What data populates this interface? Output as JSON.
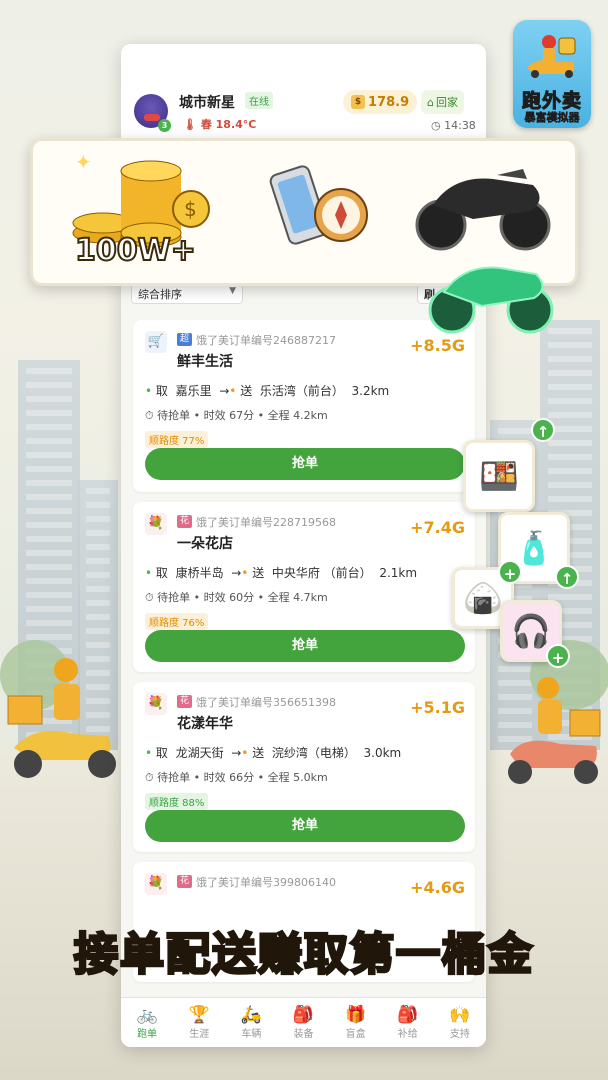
{
  "app_logo": {
    "title": "跑外卖",
    "subtitle": "暴富模拟器"
  },
  "header": {
    "user_name": "城市新星",
    "online": "在线",
    "level": "3",
    "weather": "春 18.4°C",
    "coins": "178.9",
    "home": "回家",
    "time": "14:38"
  },
  "toolbar": {
    "sort": "综合排序",
    "refresh": "刷"
  },
  "orders": [
    {
      "icon": "cart-icon",
      "tag": "超",
      "tag_color": "#4a7fd8",
      "order": "饿了美订单编号246887217",
      "name": "鲜丰生活",
      "earn": "+8.5G",
      "pickup": "嘉乐里",
      "dropoff": "乐活湾（前台）",
      "dist": "3.2km",
      "status": "待抢单",
      "timeliness": "时效 67分",
      "total": "全程 4.2km",
      "smooth": "顺路度 77%",
      "button": "抢单"
    },
    {
      "icon": "flower-icon",
      "tag": "花",
      "tag_color": "#e06b8a",
      "order": "饿了美订单编号228719568",
      "name": "一朵花店",
      "earn": "+7.4G",
      "pickup": "康桥半岛",
      "dropoff": "中央华府 （前台）",
      "dist": "2.1km",
      "status": "待抢单",
      "timeliness": "时效 60分",
      "total": "全程 4.7km",
      "smooth": "顺路度 76%",
      "button": "抢单"
    },
    {
      "icon": "flower-icon",
      "tag": "花",
      "tag_color": "#e06b8a",
      "order": "饿了美订单编号356651398",
      "name": "花漾年华",
      "earn": "+5.1G",
      "pickup": "龙湖天街",
      "dropoff": "浣纱湾（电梯）",
      "dist": "3.0km",
      "status": "待抢单",
      "timeliness": "时效 66分",
      "total": "全程 5.0km",
      "smooth": "顺路度 88%",
      "button": "抢单"
    },
    {
      "icon": "flower-icon",
      "tag": "花",
      "tag_color": "#e06b8a",
      "order": "饿了美订单编号399806140",
      "name": "",
      "earn": "+4.6G"
    }
  ],
  "labels": {
    "pickup": "取",
    "dropoff": "送",
    "arrow": "→",
    "sep": "•"
  },
  "nav": [
    {
      "label": "跑单",
      "glyph": "🚲",
      "active": true
    },
    {
      "label": "生涯",
      "glyph": "🏆"
    },
    {
      "label": "车辆",
      "glyph": "🛵"
    },
    {
      "label": "装备",
      "glyph": "🎒"
    },
    {
      "label": "盲盒",
      "glyph": "🎁"
    },
    {
      "label": "补给",
      "glyph": "🎒"
    },
    {
      "label": "支持",
      "glyph": "🙌"
    }
  ],
  "promo": {
    "coins_text": "100W+"
  },
  "slogan": "接单配送赚取第一桶金",
  "colors": {
    "accent_green": "#43a33c",
    "earn_orange": "#e69a12"
  }
}
